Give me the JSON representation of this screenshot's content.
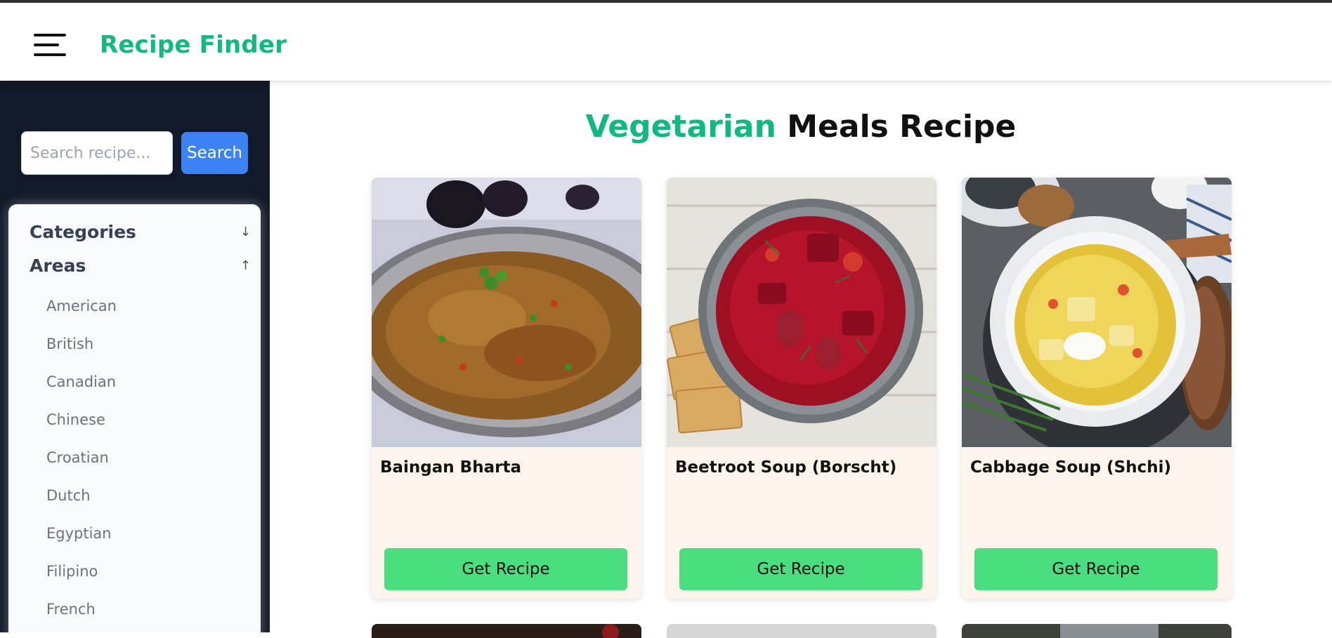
{
  "app": {
    "title": "Recipe Finder",
    "accent_color": "#10b981"
  },
  "header": {
    "menu_icon": "hamburger-icon"
  },
  "sidebar": {
    "search": {
      "placeholder": "Search recipe...",
      "value": "",
      "button_label": "Search"
    },
    "sections": [
      {
        "label": "Categories",
        "arrow": "↓",
        "expanded": false
      },
      {
        "label": "Areas",
        "arrow": "↑",
        "expanded": true
      }
    ],
    "areas": [
      "American",
      "British",
      "Canadian",
      "Chinese",
      "Croatian",
      "Dutch",
      "Egyptian",
      "Filipino",
      "French"
    ]
  },
  "main": {
    "title_accent": "Vegetarian",
    "title_rest": "Meals Recipe",
    "cards": [
      {
        "title": "Baingan Bharta",
        "button_label": "Get Recipe"
      },
      {
        "title": "Beetroot Soup (Borscht)",
        "button_label": "Get Recipe"
      },
      {
        "title": "Cabbage Soup (Shchi)",
        "button_label": "Get Recipe"
      }
    ]
  }
}
